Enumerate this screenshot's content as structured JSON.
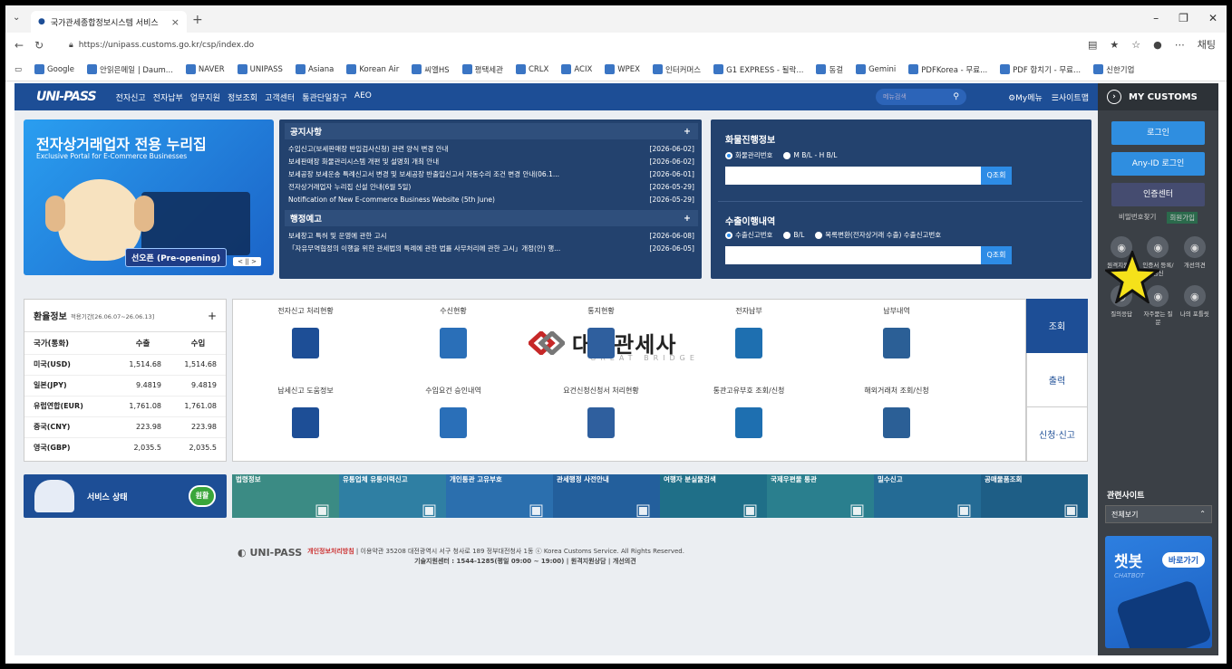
{
  "browser": {
    "tab_title": "국가관세종합정보시스템 서비스",
    "url": "https://unipass.customs.go.kr/csp/index.do",
    "bookmarks": [
      "Google",
      "안읽은메일 | Daum...",
      "NAVER",
      "UNIPASS",
      "Asiana",
      "Korean Air",
      "씨엘HS",
      "평택세관",
      "CRLX",
      "ACIX",
      "WPEX",
      "인터커머스",
      "G1 EXPRESS - 될락...",
      "동걸",
      "Gemini",
      "PDFKorea - 무료...",
      "PDF 합치기 - 무료...",
      "신한기업"
    ],
    "profile_label": "채팅"
  },
  "gnb": {
    "logo": "UNI-PASS",
    "menu": [
      "전자신고",
      "전자납부",
      "업무지원",
      "정보조회",
      "고객센터",
      "통관단일창구",
      "AEO"
    ],
    "search_placeholder": "메뉴검색",
    "my_menu": "My메뉴",
    "sitemap": "사이트맵"
  },
  "side": {
    "title": "MY CUSTOMS",
    "login": "로그인",
    "anyid": "Any-ID 로그인",
    "cert": "인증센터",
    "links": [
      "비밀번호찾기",
      "회원가입"
    ],
    "icons": [
      {
        "label": "원격지원 상담",
        "icon": "remote-icon"
      },
      {
        "label": "인증서 등록/갱신",
        "icon": "certificate-icon"
      },
      {
        "label": "개선의견",
        "icon": "feedback-icon"
      },
      {
        "label": "질의응답",
        "icon": "qna-icon"
      },
      {
        "label": "자주묻는 질문",
        "icon": "faq-icon"
      },
      {
        "label": "나의 포틀릿",
        "icon": "portlet-icon"
      }
    ],
    "related_title": "관련사이트",
    "related_select": "전체보기",
    "chatbot_title": "챗봇",
    "chatbot_go": "바로가기",
    "chatbot_en": "CHATBOT"
  },
  "banner": {
    "title": "전자상거래업자 전용 누리집",
    "subtitle": "Exclusive Portal for E-Commerce Businesses",
    "badge": "선오픈 (Pre-opening)",
    "pager": "< || >"
  },
  "notice": {
    "title": "공지사항",
    "items": [
      {
        "text": "수입신고(보세판매장 반입검사신청) 관련 양식 변경 안내",
        "date": "[2026-06-02]"
      },
      {
        "text": "보세판매장 화물관리시스템 개편 및 설명회 개최 안내",
        "date": "[2026-06-02]"
      },
      {
        "text": "보세공장 보세운송 특례신고서 변경 및 보세공장 반출입신고서 자동수리 조건 변경 안내(06.1...",
        "date": "[2026-06-01]"
      },
      {
        "text": "전자상거래업자 누리집 신설 안내(6월 5일)",
        "date": "[2026-05-29]"
      },
      {
        "text": "Notification of New E-commerce Business Website (5th June)",
        "date": "[2026-05-29]"
      }
    ],
    "admin_title": "행정예고",
    "admin_items": [
      {
        "text": "보세창고 특허 및 운영에 관한 고시",
        "date": "[2026-06-08]"
      },
      {
        "text": "「자유무역협정의 이행을 위한 관세법의 특례에 관한 법률 사무처리에 관한 고시」개정(안) 행...",
        "date": "[2026-06-05]"
      }
    ]
  },
  "cargo": {
    "title": "화물진행정보",
    "radio1": "화물관리번호",
    "radio2": "M B/L - H B/L",
    "btn": "Q조회",
    "export_title": "수출이행내역",
    "eradio1": "수출신고번호",
    "eradio2": "B/L",
    "eradio3": "목록변환(전자상거래 수출) 수출신고번호",
    "ebtn": "Q조회"
  },
  "exchange": {
    "title": "환율정보",
    "period": "적용기간[26.06.07~26.06.13]",
    "headers": [
      "국가(통화)",
      "수출",
      "수입"
    ],
    "rows": [
      [
        "미국(USD)",
        "1,514.68",
        "1,514.68"
      ],
      [
        "일본(JPY)",
        "9.4819",
        "9.4819"
      ],
      [
        "유럽연합(EUR)",
        "1,761.08",
        "1,761.08"
      ],
      [
        "중국(CNY)",
        "223.98",
        "223.98"
      ],
      [
        "영국(GBP)",
        "2,035.5",
        "2,035.5"
      ]
    ]
  },
  "services": [
    {
      "label": "전자신고 처리현황",
      "icon": "chart-icon"
    },
    {
      "label": "수신현황",
      "icon": "inbox-icon"
    },
    {
      "label": "통지현황",
      "icon": "notice-icon"
    },
    {
      "label": "전자납부",
      "icon": "payment-icon"
    },
    {
      "label": "납부내역",
      "icon": "receipt-icon"
    },
    {
      "label": "납세신고 도움정보",
      "icon": "help-book-icon"
    },
    {
      "label": "수입요건 승인내역",
      "icon": "import-icon"
    },
    {
      "label": "요건신청신청서 처리현황",
      "icon": "pie-icon"
    },
    {
      "label": "통관고유부호 조회/신청",
      "icon": "barcode-search-icon"
    },
    {
      "label": "해외거래처 조회/신청",
      "icon": "globe-search-icon"
    }
  ],
  "tabs": [
    "조회",
    "출력",
    "신청·신고"
  ],
  "watermark": {
    "brand": "대교관세사",
    "sub": "GREAT BRIDGE"
  },
  "status": {
    "label": "서비스 상태",
    "state": "원활"
  },
  "quick": [
    {
      "label": "법령정보",
      "color": "#3b8b84"
    },
    {
      "label": "유통업체 유통이력신고",
      "color": "#2f7fa3"
    },
    {
      "label": "개인통관 고유부호",
      "color": "#2b6fae"
    },
    {
      "label": "관세행정 사전안내",
      "color": "#235f9c"
    },
    {
      "label": "여행자 분실물검색",
      "color": "#1f6f88"
    },
    {
      "label": "국제우편물 통관",
      "color": "#2a7f8e"
    },
    {
      "label": "밀수신고",
      "color": "#246b95"
    },
    {
      "label": "공매물품조회",
      "color": "#1e5e86"
    }
  ],
  "footer": {
    "logo": "UNI-PASS",
    "privacy": "개인정보처리방침",
    "terms": "이용약관",
    "address": "35208 대전광역시 서구 청사로 189 정부대전청사 1동 ⓒ Korea Customs Service. All Rights Reserved.",
    "tel": "기술지원센터 : 1544-1285(평일 09:00 ~ 19:00)",
    "remote": "원격지원상담",
    "opinion": "개선의견"
  }
}
